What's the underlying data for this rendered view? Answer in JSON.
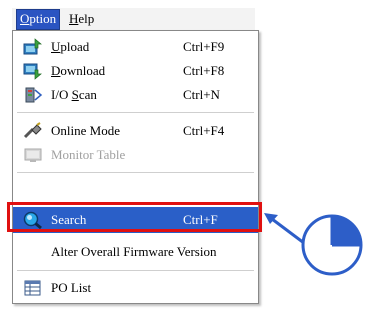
{
  "menubar": {
    "option": {
      "first": "O",
      "rest": "ption"
    },
    "help": {
      "first": "H",
      "rest": "elp"
    }
  },
  "menu": {
    "upload": {
      "first": "U",
      "rest": "pload",
      "shortcut": "Ctrl+F9"
    },
    "download": {
      "first": "D",
      "rest": "ownload",
      "shortcut": "Ctrl+F8"
    },
    "io_scan": {
      "pre": "I/O ",
      "first": "S",
      "rest": "can",
      "shortcut": "Ctrl+N"
    },
    "online_mode": {
      "label": "Online Mode",
      "shortcut": "Ctrl+F4"
    },
    "monitor_table": {
      "label": "Monitor Table"
    },
    "search": {
      "label": "Search",
      "shortcut": "Ctrl+F"
    },
    "alter_firmware": {
      "label": "Alter Overall Firmware Version"
    },
    "po_list": {
      "label": "PO List"
    }
  },
  "colors": {
    "selection": "#2a5fc8",
    "highlight_frame": "#e01010",
    "arrow": "#2d5ec8"
  },
  "icons": {
    "upload": "upload-icon",
    "download": "download-icon",
    "io_scan": "io-scan-icon",
    "online_mode": "online-mode-icon",
    "monitor_table": "monitor-table-icon",
    "search": "search-icon",
    "po_list": "po-list-icon"
  }
}
